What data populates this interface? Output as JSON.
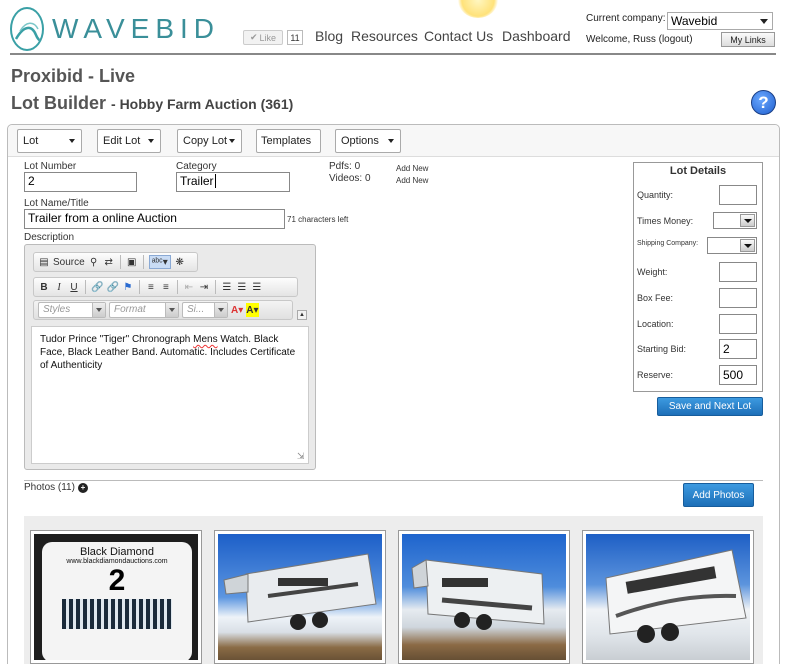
{
  "header": {
    "brand": "WAVEBID",
    "like_label": "Like",
    "like_count": "11",
    "nav": [
      "Blog",
      "Resources",
      "Contact Us",
      "Dashboard"
    ],
    "company_label": "Current company:",
    "company_value": "Wavebid",
    "welcome": "Welcome, Russ (logout)",
    "my_links": "My Links"
  },
  "page": {
    "title": "Proxibid - Live",
    "subtitle": "Lot Builder",
    "auction": "- Hobby Farm Auction (361)",
    "help": "?"
  },
  "toolbar": {
    "items": [
      "Lot",
      "Edit Lot",
      "Copy Lot",
      "Templates",
      "Options"
    ]
  },
  "form": {
    "lot_number_label": "Lot Number",
    "lot_number_value": "2",
    "category_label": "Category",
    "category_value": "Trailer",
    "pdfs_label": "Pdfs: 0",
    "videos_label": "Videos: 0",
    "add_new_1": "Add New",
    "add_new_2": "Add New",
    "name_label": "Lot Name/Title",
    "name_value": "Trailer from a online Auction",
    "chars_left": "71 characters left",
    "description_label": "Description"
  },
  "editor": {
    "source_label": "Source",
    "styles_placeholder": "Styles",
    "format_placeholder": "Format",
    "size_placeholder": "Si...",
    "text_part1": "Tudor Prince \"Tiger\" Chronograph ",
    "text_spell": "Mens",
    "text_part2": " Watch. Black Face, Black Leather Band. Automatic. Includes Certificate of Authenticity"
  },
  "details": {
    "title": "Lot Details",
    "quantity": "Quantity:",
    "times_money": "Times Money:",
    "shipping": "Shipping Company:",
    "weight": "Weight:",
    "box_fee": "Box Fee:",
    "location": "Location:",
    "starting_bid": "Starting Bid:",
    "starting_bid_value": "2",
    "reserve": "Reserve:",
    "reserve_value": "500",
    "save_next": "Save and Next Lot"
  },
  "photos": {
    "label": "Photos (11)",
    "add_button": "Add Photos",
    "tag_title": "Black Diamond",
    "tag_url": "www.blackdiamondauctions.com",
    "tag_number": "2"
  },
  "colors": {
    "brand_teal": "#3a8f99",
    "button_blue": "#1d6fb8"
  }
}
